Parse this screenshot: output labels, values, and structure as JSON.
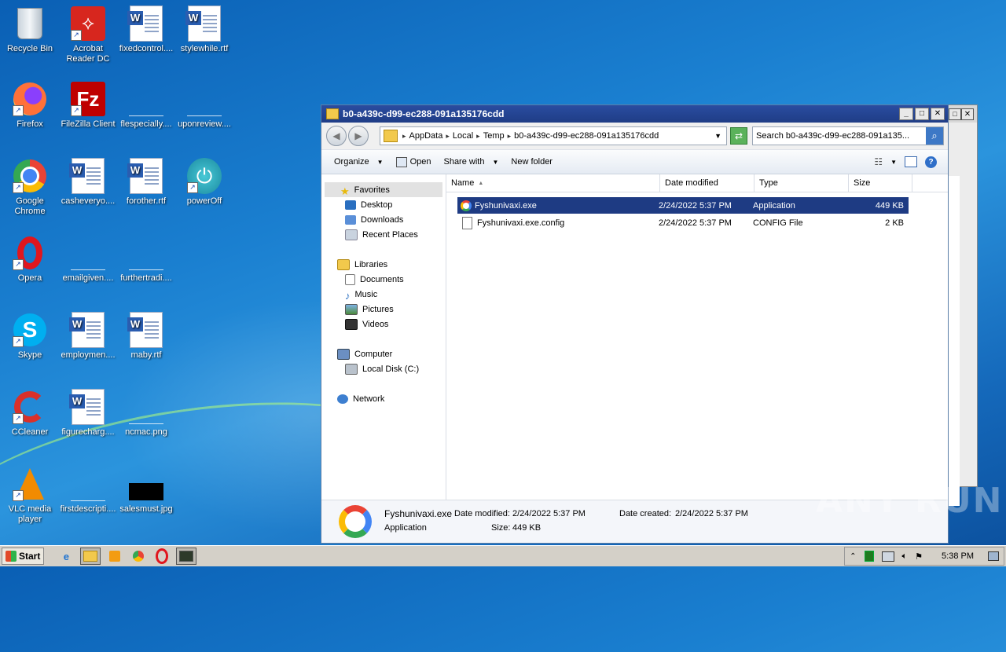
{
  "desktop": {
    "icons": [
      {
        "label": "Recycle Bin",
        "icon": "recycle-bin-icon"
      },
      {
        "label": "Acrobat Reader DC",
        "label_line1": "Acrobat",
        "label_line2": "Reader DC",
        "icon": "acrobat-icon"
      },
      {
        "label": "fixedcontrol....",
        "icon": "word-doc-icon"
      },
      {
        "label": "stylewhile.rtf",
        "icon": "word-doc-icon"
      },
      {
        "label": "Firefox",
        "icon": "firefox-icon"
      },
      {
        "label": "FileZilla Client",
        "icon": "filezilla-icon"
      },
      {
        "label": "flespecially....",
        "icon": "blank-file-icon"
      },
      {
        "label": "uponreview....",
        "icon": "blank-file-icon"
      },
      {
        "label": "Google Chrome",
        "label_line1": "Google",
        "label_line2": "Chrome",
        "icon": "chrome-icon"
      },
      {
        "label": "casheveryo....",
        "icon": "word-doc-icon"
      },
      {
        "label": "forother.rtf",
        "icon": "word-doc-icon"
      },
      {
        "label": "powerOff",
        "icon": "power-icon"
      },
      {
        "label": "Opera",
        "icon": "opera-icon"
      },
      {
        "label": "emailgiven....",
        "icon": "blank-file-icon"
      },
      {
        "label": "furthertradi....",
        "icon": "blank-file-icon"
      },
      {
        "label": "Skype",
        "icon": "skype-icon"
      },
      {
        "label": "employmen....",
        "icon": "word-doc-icon"
      },
      {
        "label": "maby.rtf",
        "icon": "word-doc-icon"
      },
      {
        "label": "CCleaner",
        "icon": "ccleaner-icon"
      },
      {
        "label": "figurecharg....",
        "icon": "word-doc-icon"
      },
      {
        "label": "ncmac.png",
        "icon": "blank-file-icon"
      },
      {
        "label": "VLC media player",
        "label_line1": "VLC media",
        "label_line2": "player",
        "icon": "vlc-icon"
      },
      {
        "label": "firstdescripti....",
        "icon": "blank-file-icon"
      },
      {
        "label": "salesmust.jpg",
        "icon": "image-file-icon"
      }
    ]
  },
  "explorer": {
    "title": "b0-a439c-d99-ec288-091a135176cdd",
    "address": [
      "AppData",
      "Local",
      "Temp",
      "b0-a439c-d99-ec288-091a135176cdd"
    ],
    "search_placeholder": "Search b0-a439c-d99-ec288-091a135...",
    "toolbar": {
      "organize": "Organize",
      "open": "Open",
      "share_with": "Share with",
      "new_folder": "New folder"
    },
    "nav": {
      "favorites": "Favorites",
      "desktop": "Desktop",
      "downloads": "Downloads",
      "recent_places": "Recent Places",
      "libraries": "Libraries",
      "documents": "Documents",
      "music": "Music",
      "pictures": "Pictures",
      "videos": "Videos",
      "computer": "Computer",
      "local_disk": "Local Disk (C:)",
      "network": "Network"
    },
    "columns": {
      "name": "Name",
      "date_modified": "Date modified",
      "type": "Type",
      "size": "Size"
    },
    "files": [
      {
        "name": "Fyshunivaxi.exe",
        "date": "2/24/2022 5:37 PM",
        "type": "Application",
        "size": "449 KB"
      },
      {
        "name": "Fyshunivaxi.exe.config",
        "date": "2/24/2022 5:37 PM",
        "type": "CONFIG File",
        "size": "2 KB"
      }
    ],
    "details": {
      "name": "Fyshunivaxi.exe",
      "kind": "Application",
      "modified_label": "Date modified:",
      "modified_value": "2/24/2022 5:37 PM",
      "created_label": "Date created:",
      "created_value": "2/24/2022 5:37 PM",
      "size_label": "Size:",
      "size_value": "449 KB"
    }
  },
  "taskbar": {
    "start": "Start",
    "clock": "5:38 PM"
  },
  "watermark": "ANY RUN"
}
